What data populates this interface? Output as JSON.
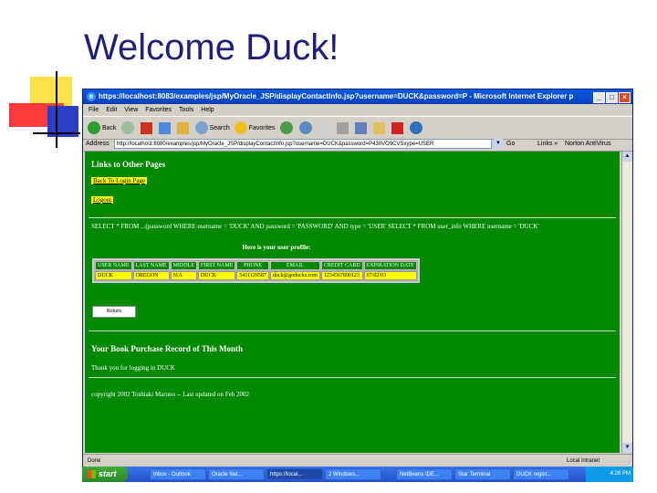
{
  "slide": {
    "title": "Welcome Duck!"
  },
  "window": {
    "title": "https://localhost:8083/examples/jsp/MyOracle_JSP/displayContactInfo.jsp?username=DUCK&password=P - Microsoft Internet Explorer p",
    "buttons": {
      "minimize": "_",
      "maximize": "□",
      "close": "×"
    }
  },
  "menubar": [
    "File",
    "Edit",
    "View",
    "Favorites",
    "Tools",
    "Help"
  ],
  "toolbar": {
    "back": "Back",
    "search": "Search",
    "favorites": "Favorites"
  },
  "addressbar": {
    "label": "Address",
    "url": "http://localhost:8080/examples/jsp/MyOracle_JSP/displayContactInfo.jsp?username=DUCK&password=P430VO9CVSxype=USER",
    "go": "Go",
    "links": "Links »",
    "norton": "Norton AntiVirus"
  },
  "content": {
    "links_heading": "Links to Other Pages",
    "back_link": "Back To Login Page",
    "logout_link": "Logout",
    "sql_text": "SELECT * FROM ...(password WHERE username = 'DUCK' AND password = 'PASSWORD' AND type = 'USER' SELECT * FROM user_info WHERE username = 'DUCK'",
    "profile_heading": "Here is your user profile:",
    "profile_columns": [
      "USER NAME",
      "LAST NAME",
      "MIDDLE",
      "FIRST NAME",
      "PHONE",
      "EMAIL",
      "CREDIT CARD",
      "EXPIRATION DATE"
    ],
    "profile_row": [
      "DUCK",
      "OREGON",
      "N/A",
      "DUCK",
      "5411129587",
      "duck@goducks.com",
      "1234567890123",
      "07/02/03"
    ],
    "return_button": "Return",
    "purchase_heading": "Your Book Purchase Record of This Month",
    "thanks": "Thank you for logging in DUCK",
    "copyright": "copyright 2002 Toshiaki Maruno -- Last updated on Feb 2002"
  },
  "statusbar": {
    "text": "Done",
    "zone": "Local intranet"
  },
  "taskbar": {
    "start": "start",
    "tasks": [
      "Inbox - Outlook",
      "Oracle Net...",
      "https://local...",
      "2 Windows...",
      "NetBeans IDE...",
      "Star Terminal",
      "DUCK regist..."
    ],
    "clock": "4:28 PM"
  },
  "colors": {
    "page_bg": "#008800",
    "link_bg": "#ffff00",
    "title_color": "#1f1f7a"
  }
}
